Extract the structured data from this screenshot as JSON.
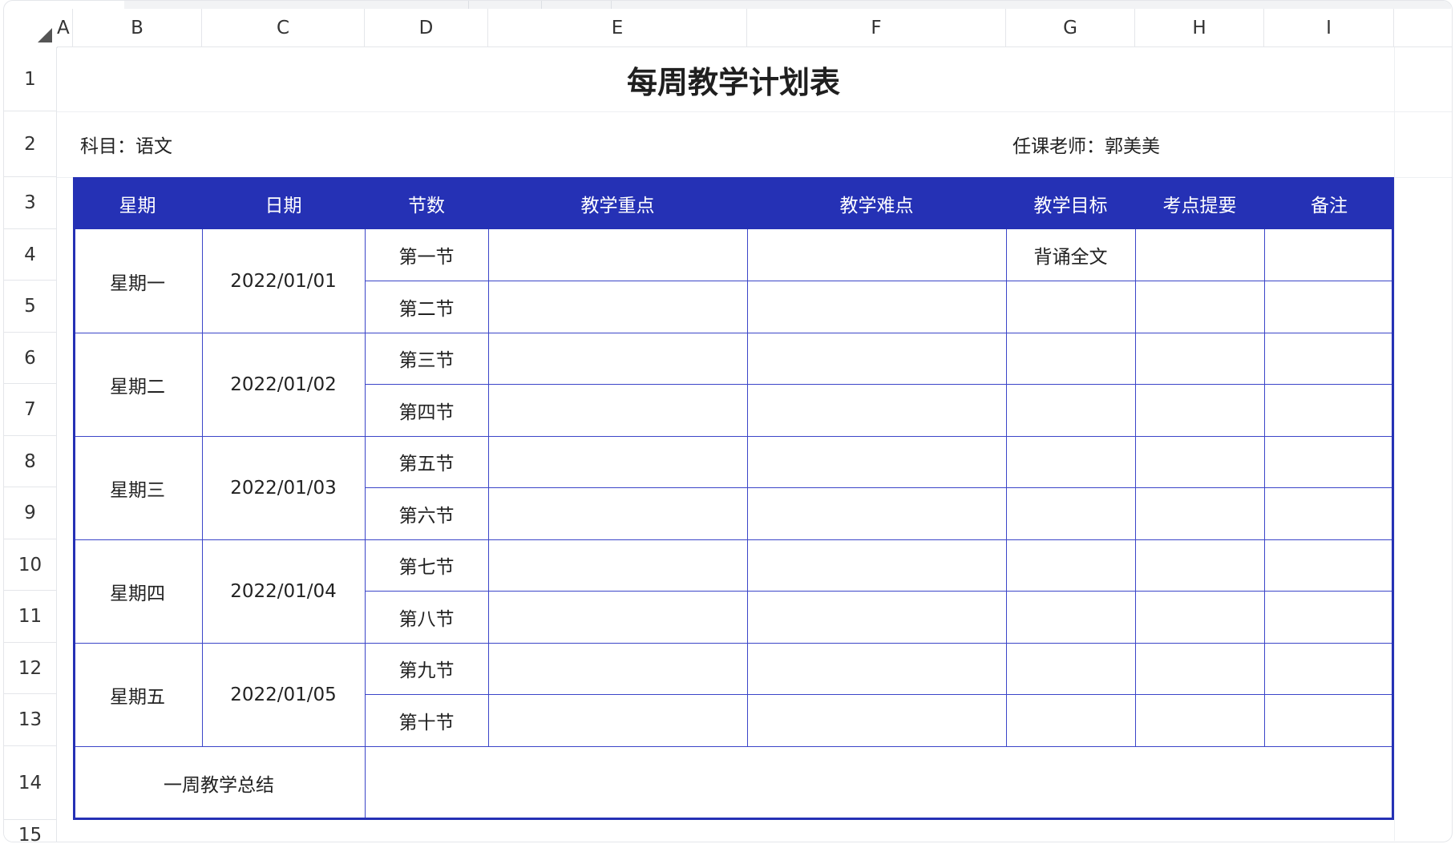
{
  "columns": [
    "A",
    "B",
    "C",
    "D",
    "E",
    "F",
    "G",
    "H",
    "I"
  ],
  "rows": [
    "1",
    "2",
    "3",
    "4",
    "5",
    "6",
    "7",
    "8",
    "9",
    "10",
    "11",
    "12",
    "13",
    "14",
    "15"
  ],
  "sheet": {
    "title": "每周教学计划表",
    "subject_label": "科目：语文",
    "teacher_label": "任课老师：郭美美",
    "headers": [
      "星期",
      "日期",
      "节数",
      "教学重点",
      "教学难点",
      "教学目标",
      "考点提要",
      "备注"
    ],
    "days": [
      {
        "weekday": "星期一",
        "date": "2022/01/01"
      },
      {
        "weekday": "星期二",
        "date": "2022/01/02"
      },
      {
        "weekday": "星期三",
        "date": "2022/01/03"
      },
      {
        "weekday": "星期四",
        "date": "2022/01/04"
      },
      {
        "weekday": "星期五",
        "date": "2022/01/05"
      }
    ],
    "lessons": [
      "第一节",
      "第二节",
      "第三节",
      "第四节",
      "第五节",
      "第六节",
      "第七节",
      "第八节",
      "第九节",
      "第十节"
    ],
    "goal_row4": "背诵全文",
    "summary_label": "一周教学总结"
  },
  "colors": {
    "header_bg": "#2531b5",
    "header_text": "#ffffff",
    "table_line": "#3b45c8"
  }
}
